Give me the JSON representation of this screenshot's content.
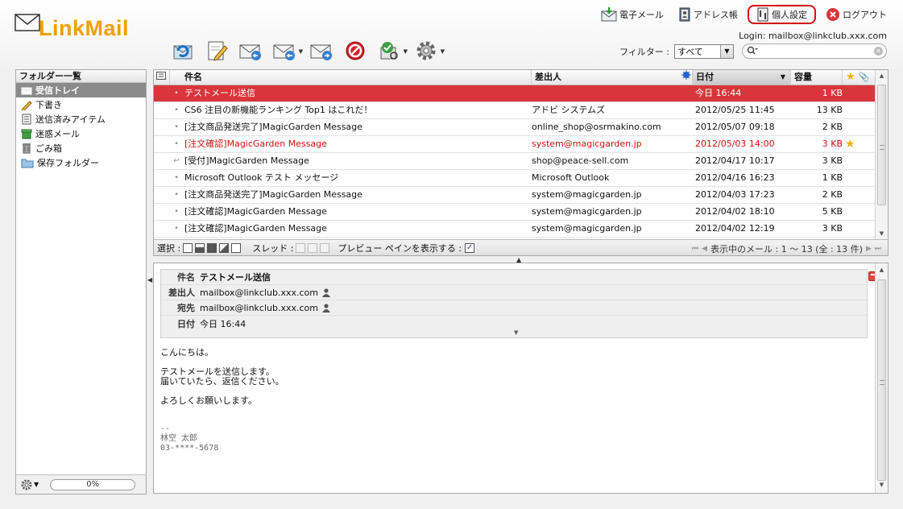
{
  "app": {
    "logo_text": "LinkMail"
  },
  "topnav": [
    {
      "label": "電子メール",
      "icon": "mail-download-icon"
    },
    {
      "label": "アドレス帳",
      "icon": "address-book-icon"
    },
    {
      "label": "個人設定",
      "icon": "personal-settings-icon",
      "active": true
    },
    {
      "label": "ログアウト",
      "icon": "logout-icon"
    }
  ],
  "login": "Login: mailbox@linkclub.xxx.com",
  "toolbar": [
    {
      "name": "check-mail-button",
      "icon": "refresh-mail-icon"
    },
    {
      "name": "compose-button",
      "icon": "compose-icon"
    },
    {
      "name": "reply-button",
      "icon": "reply-icon"
    },
    {
      "name": "reply-all-button",
      "icon": "reply-all-icon",
      "dropdown": true
    },
    {
      "name": "forward-button",
      "icon": "forward-icon"
    },
    {
      "name": "delete-button",
      "icon": "delete-icon"
    },
    {
      "name": "mark-button",
      "icon": "mark-read-icon",
      "dropdown": true
    },
    {
      "name": "settings-button",
      "icon": "gear-icon",
      "dropdown": true
    }
  ],
  "filter": {
    "label": "フィルター :",
    "value": "すべて"
  },
  "search": {
    "placeholder": ""
  },
  "sidebar": {
    "title": "フォルダー一覧",
    "folders": [
      {
        "label": "受信トレイ",
        "icon": "inbox-icon",
        "selected": true
      },
      {
        "label": "下書き",
        "icon": "drafts-icon"
      },
      {
        "label": "送信済みアイテム",
        "icon": "sent-icon"
      },
      {
        "label": "迷惑メール",
        "icon": "junk-icon"
      },
      {
        "label": "ごみ箱",
        "icon": "trash-icon"
      },
      {
        "label": "保存フォルダー",
        "icon": "folder-icon"
      }
    ],
    "quota": "0%"
  },
  "list": {
    "columns": {
      "subject": "件名",
      "from": "差出人",
      "date": "日付",
      "size": "容量"
    },
    "rows": [
      {
        "subject": "テストメール送信",
        "from": "",
        "date": "今日 16:44",
        "size": "1 KB",
        "selected": true,
        "icon": "•"
      },
      {
        "subject": "CS6 注目の新機能ランキング Top1 はこれだ！",
        "from": "アドビ システムズ",
        "date": "2012/05/25 11:45",
        "size": "13 KB",
        "icon": "•"
      },
      {
        "subject": "[注文商品発送完了]MagicGarden Message",
        "from": "online_shop@osrmakino.com",
        "date": "2012/05/07 09:18",
        "size": "2 KB",
        "icon": "•"
      },
      {
        "subject": "[注文確認]MagicGarden Message",
        "from": "system@magicgarden.jp",
        "date": "2012/05/03 14:00",
        "size": "3 KB",
        "unread": true,
        "starred": true,
        "icon": "•"
      },
      {
        "subject": "[受付]MagicGarden Message",
        "from": "shop@peace-sell.com",
        "date": "2012/04/17 10:17",
        "size": "3 KB",
        "icon": "↩"
      },
      {
        "subject": "Microsoft Outlook テスト メッセージ",
        "from": "Microsoft Outlook",
        "date": "2012/04/16 16:23",
        "size": "1 KB",
        "icon": "•"
      },
      {
        "subject": "[注文商品発送完了]MagicGarden Message",
        "from": "system@magicgarden.jp",
        "date": "2012/04/03 17:23",
        "size": "2 KB",
        "icon": "•"
      },
      {
        "subject": "[注文確認]MagicGarden Message",
        "from": "system@magicgarden.jp",
        "date": "2012/04/02 18:10",
        "size": "5 KB",
        "icon": "•"
      },
      {
        "subject": "[注文確認]MagicGarden Message",
        "from": "system@magicgarden.jp",
        "date": "2012/04/02 12:19",
        "size": "3 KB",
        "icon": "•"
      }
    ]
  },
  "status": {
    "select_label": "選択 :",
    "thread_label": "スレッド :",
    "preview_label": "プレビュー ペインを表示する :",
    "pager": "表示中のメール : 1 〜 13 (全 : 13 件)"
  },
  "preview": {
    "subject_label": "件名",
    "subject": "テストメール送信",
    "from_label": "差出人",
    "from": "mailbox@linkclub.xxx.com",
    "to_label": "宛先",
    "to": "mailbox@linkclub.xxx.com",
    "date_label": "日付",
    "date": "今日 16:44",
    "body": "こんにちは。\n\nテストメールを送信します。\n届いていたら、返信ください。\n\nよろしくお願いします。",
    "signature": "--\n林空 太郎\n03-****-5678"
  },
  "colors": {
    "accent": "#d9353a",
    "unread": "#d01010",
    "logo": "#f0a000"
  }
}
